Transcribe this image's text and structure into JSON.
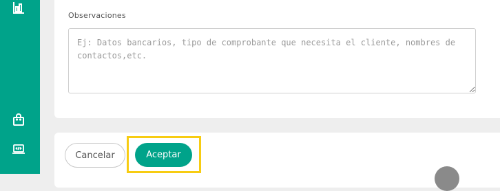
{
  "sidebar": {
    "icons": [
      "bar-chart-icon",
      "shopping-bag-icon",
      "laptop-code-icon"
    ]
  },
  "form": {
    "observations_label": "Observaciones",
    "observations_placeholder": "Ej: Datos bancarios, tipo de comprobante que necesita el cliente, nombres de contactos,etc.",
    "observations_value": ""
  },
  "actions": {
    "cancel_label": "Cancelar",
    "accept_label": "Aceptar"
  },
  "colors": {
    "brand": "#00a38a",
    "highlight": "#f7cc12",
    "background": "#eeeeee"
  }
}
